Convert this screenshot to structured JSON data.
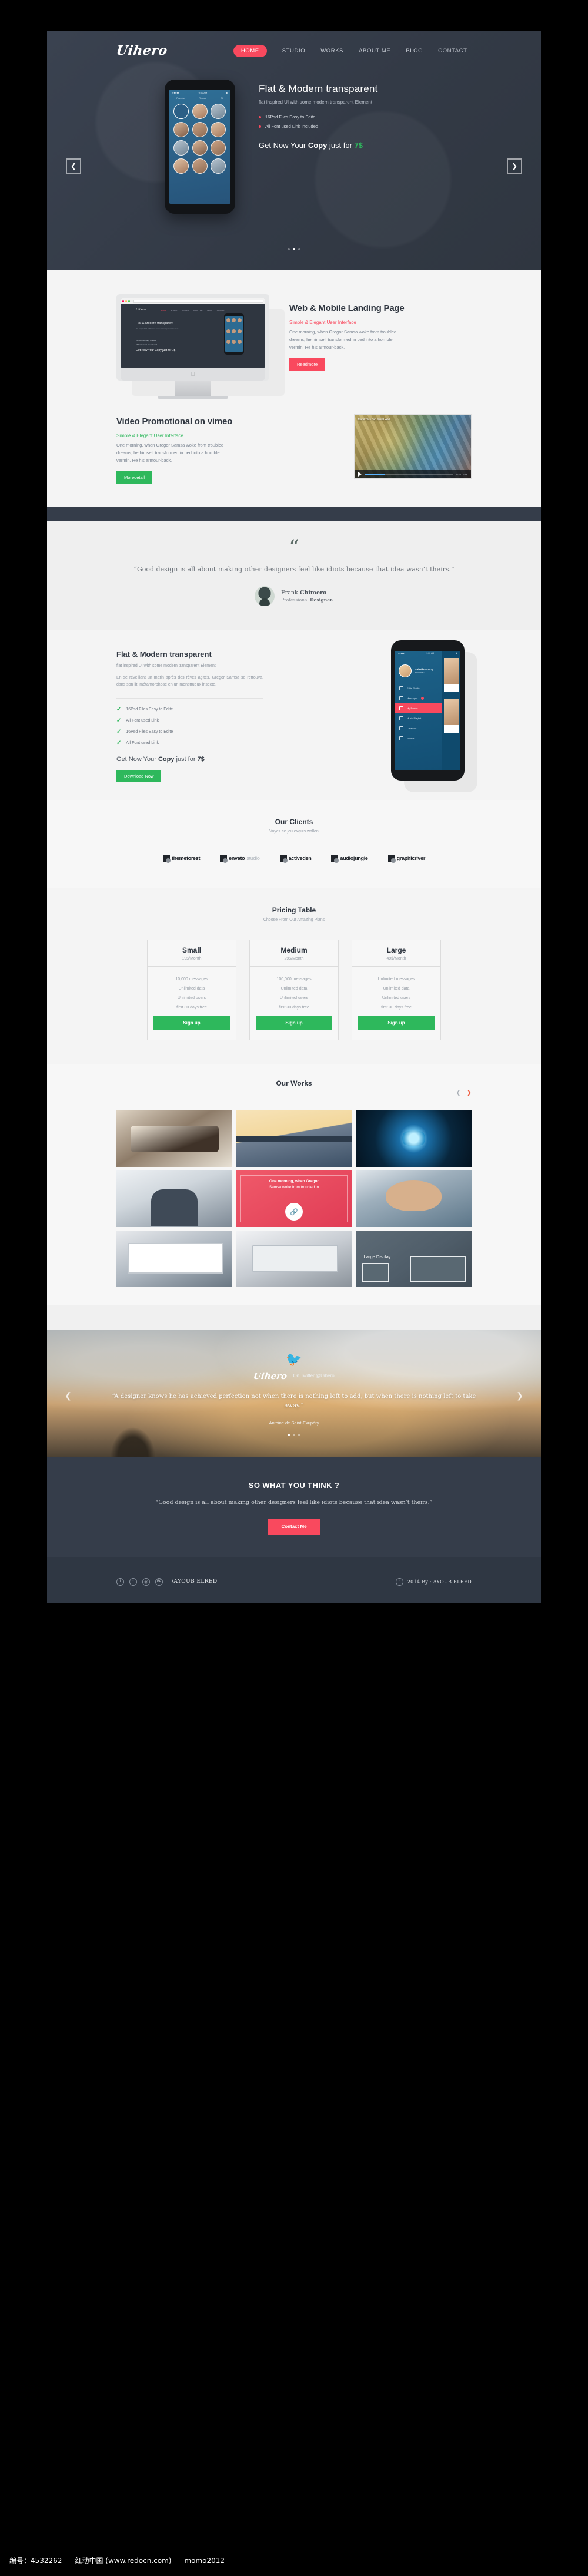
{
  "header": {
    "logo": "Uihero",
    "nav": [
      {
        "label": "HOME",
        "active": true
      },
      {
        "label": "STUDIO",
        "active": false
      },
      {
        "label": "WORKS",
        "active": false
      },
      {
        "label": "ABOUT ME",
        "active": false
      },
      {
        "label": "BLOG",
        "active": false
      },
      {
        "label": "CONTACT",
        "active": false
      }
    ]
  },
  "hero": {
    "prev_icon": "chevron-left-icon",
    "next_icon": "chevron-right-icon",
    "title": "Flat & Modern transparent",
    "subtitle": "flat inspired UI with some modern transparent Element",
    "bullets": [
      "16Psd Files Easy to Edite",
      "All Font used Link Included"
    ],
    "price_text": "Get Now Your Copy just for 7$",
    "price_pre": "Get Now Your ",
    "price_bold": "Copy",
    "price_mid": " just for ",
    "price_amount": "7$",
    "phone_time": "9:00 AM",
    "phone_tabs": [
      "Friends",
      "Recent",
      "All"
    ]
  },
  "landing": {
    "title": "Web & Mobile Landing Page",
    "kicker": "Simple & Elegant User Interface",
    "paragraph": "One morning, when Gregor Samsa woke from troubled dreams, he himself transformed in bed into a horrible vermin. He  his armour-back.",
    "button": "Readmore",
    "mockup": {
      "logo": "Uihero",
      "nav": [
        "HOME",
        "STUDIO",
        "WORKS",
        "ABOUT ME",
        "BLOG",
        "CONTACT"
      ],
      "headline": "Flat & Modern transparent",
      "sub": "flat inspired UI with some modern transparent Element",
      "bullets": [
        "16Psd Files Easy to Edite",
        "All Font used Link Included"
      ],
      "price": "Get Now Your Copy just for 7$"
    }
  },
  "video": {
    "title": "Video Promotional on vimeo",
    "kicker": "Simple & Elegant User Interface",
    "paragraph": "One morning, when Gregor Samsa woke from troubled dreams, he himself transformed in bed into a horrible vermin. He  his armour-back.",
    "button": "Moredetail",
    "thumb_title": "Mural Tiles Fun Street Wall",
    "thumb_time": "0:24 / 2:18",
    "play_icon": "play-icon"
  },
  "testimonial": {
    "quote_mark": "“",
    "quote": "“Good design is all about making other designers feel like idiots because that idea wasn’t theirs.”",
    "name_first": "Frank ",
    "name_last": "Chimero",
    "role_pre": "Professional ",
    "role_bold": "Designer."
  },
  "flat": {
    "title": "Flat & Modern transparent",
    "subtitle": "flat inspired UI with some modern transparent Element",
    "paragraph": "En se réveillant un matin après des rêves agités, Gregor Samsa se retrouva, dans son lit, métamorphosé en un monstrueux insecte.",
    "checks": [
      "16Psd Files Easy to Edite",
      "All Font used Link",
      "16Psd Files Easy to Edite",
      "All Font used Link"
    ],
    "check_icon": "check-icon",
    "price_pre": "Get Now Your ",
    "price_bold": "Copy",
    "price_mid": " just for ",
    "price_amount": "7$",
    "button": "Download Now",
    "phone": {
      "time": "9:00 AM",
      "user_first": "Isabelle ",
      "user_last": "Nouray",
      "welcome": "Welcome !",
      "menu": [
        "Edite Profile",
        "Messages",
        "My Postes",
        "Music Playlist",
        "Calandar",
        "Photos"
      ],
      "active_index": 2,
      "latest_label": "Latest",
      "cards": [
        "Summer jean",
        "Vintage Fashion"
      ]
    }
  },
  "clients": {
    "title": "Our Clients",
    "subtitle": "Voyez ce jeu exquis wallon",
    "logos": [
      {
        "name": "themeforest",
        "bold": "themeforest",
        "dim": ""
      },
      {
        "name": "envato-studio",
        "bold": "envato",
        "dim": "studio"
      },
      {
        "name": "activeden",
        "bold": "activeden",
        "dim": ""
      },
      {
        "name": "audiojungle",
        "bold": "audiojungle",
        "dim": ""
      },
      {
        "name": "graphicriver",
        "bold": "graphicriver",
        "dim": ""
      }
    ]
  },
  "pricing": {
    "title": "Pricing Table",
    "subtitle": "Choose From Our Amazing Plans",
    "plans": [
      {
        "name": "Small",
        "price": "19$/Month",
        "features": [
          "10,000 messages",
          "Unlimited data",
          "Unlimited users",
          "first 30 days free"
        ],
        "bold_parts": [
          "",
          "Unlimited",
          "Unlimited",
          ""
        ],
        "button": "Sign up"
      },
      {
        "name": "Medium",
        "price": "29$/Month",
        "features": [
          "100,000 messages",
          "Unlimited data",
          "Unlimited users",
          "first 30 days free"
        ],
        "bold_parts": [
          "",
          "Unlimited",
          "Unlimited",
          ""
        ],
        "button": "Sign up"
      },
      {
        "name": "Large",
        "price": "49$/Month",
        "features": [
          "Unlimited messages",
          "Unlimited data",
          "Unlimited users",
          "first 30 days free"
        ],
        "bold_parts": [
          "Unlimited",
          "Unlimited",
          "Unlimited",
          ""
        ],
        "button": "Sign up"
      }
    ]
  },
  "works": {
    "title": "Our Works",
    "prev_icon": "chevron-left-icon",
    "next_icon": "chevron-right-icon",
    "overlay": {
      "line1": "One morning, when Gregor",
      "line2": "Samsa woke from troubled in",
      "link_icon": "link-icon"
    },
    "large_display_label": "Large Display"
  },
  "twitter": {
    "bird_icon": "twitter-bird-icon",
    "logo": "Uihero",
    "handle": "On Twitter @Uihero",
    "quote": "“A designer knows he has achieved perfection not when there is nothing left to add, but when there is nothing left to take away.”",
    "author": "Antoine de Saint-Exupéry",
    "prev_icon": "chevron-left-icon",
    "next_icon": "chevron-right-icon"
  },
  "cta": {
    "title": "SO WHAT YOU THINK ?",
    "quote": "“Good design is all about making other designers feel like idiots because that idea wasn’t theirs.”",
    "button": "Contact Me"
  },
  "footer": {
    "socials": [
      {
        "icon": "facebook-icon",
        "glyph": "f"
      },
      {
        "icon": "twitter-icon",
        "glyph": "ᵛ"
      },
      {
        "icon": "dribbble-icon",
        "glyph": "Ⓓ"
      },
      {
        "icon": "behance-icon",
        "glyph": "Bē"
      }
    ],
    "name": "/AYOUB ELRED",
    "copyright_icon": "copyright-icon",
    "copyright": "2014  By : AYOUB ELRED"
  },
  "watermark": {
    "id_label": "编号：4532262",
    "site": "红动中国 (www.redocn.com)",
    "user": "momo2012"
  },
  "colors": {
    "dark": "#353d4a",
    "red": "#f9495e",
    "green": "#2eb85c",
    "light": "#f4f4f4"
  }
}
